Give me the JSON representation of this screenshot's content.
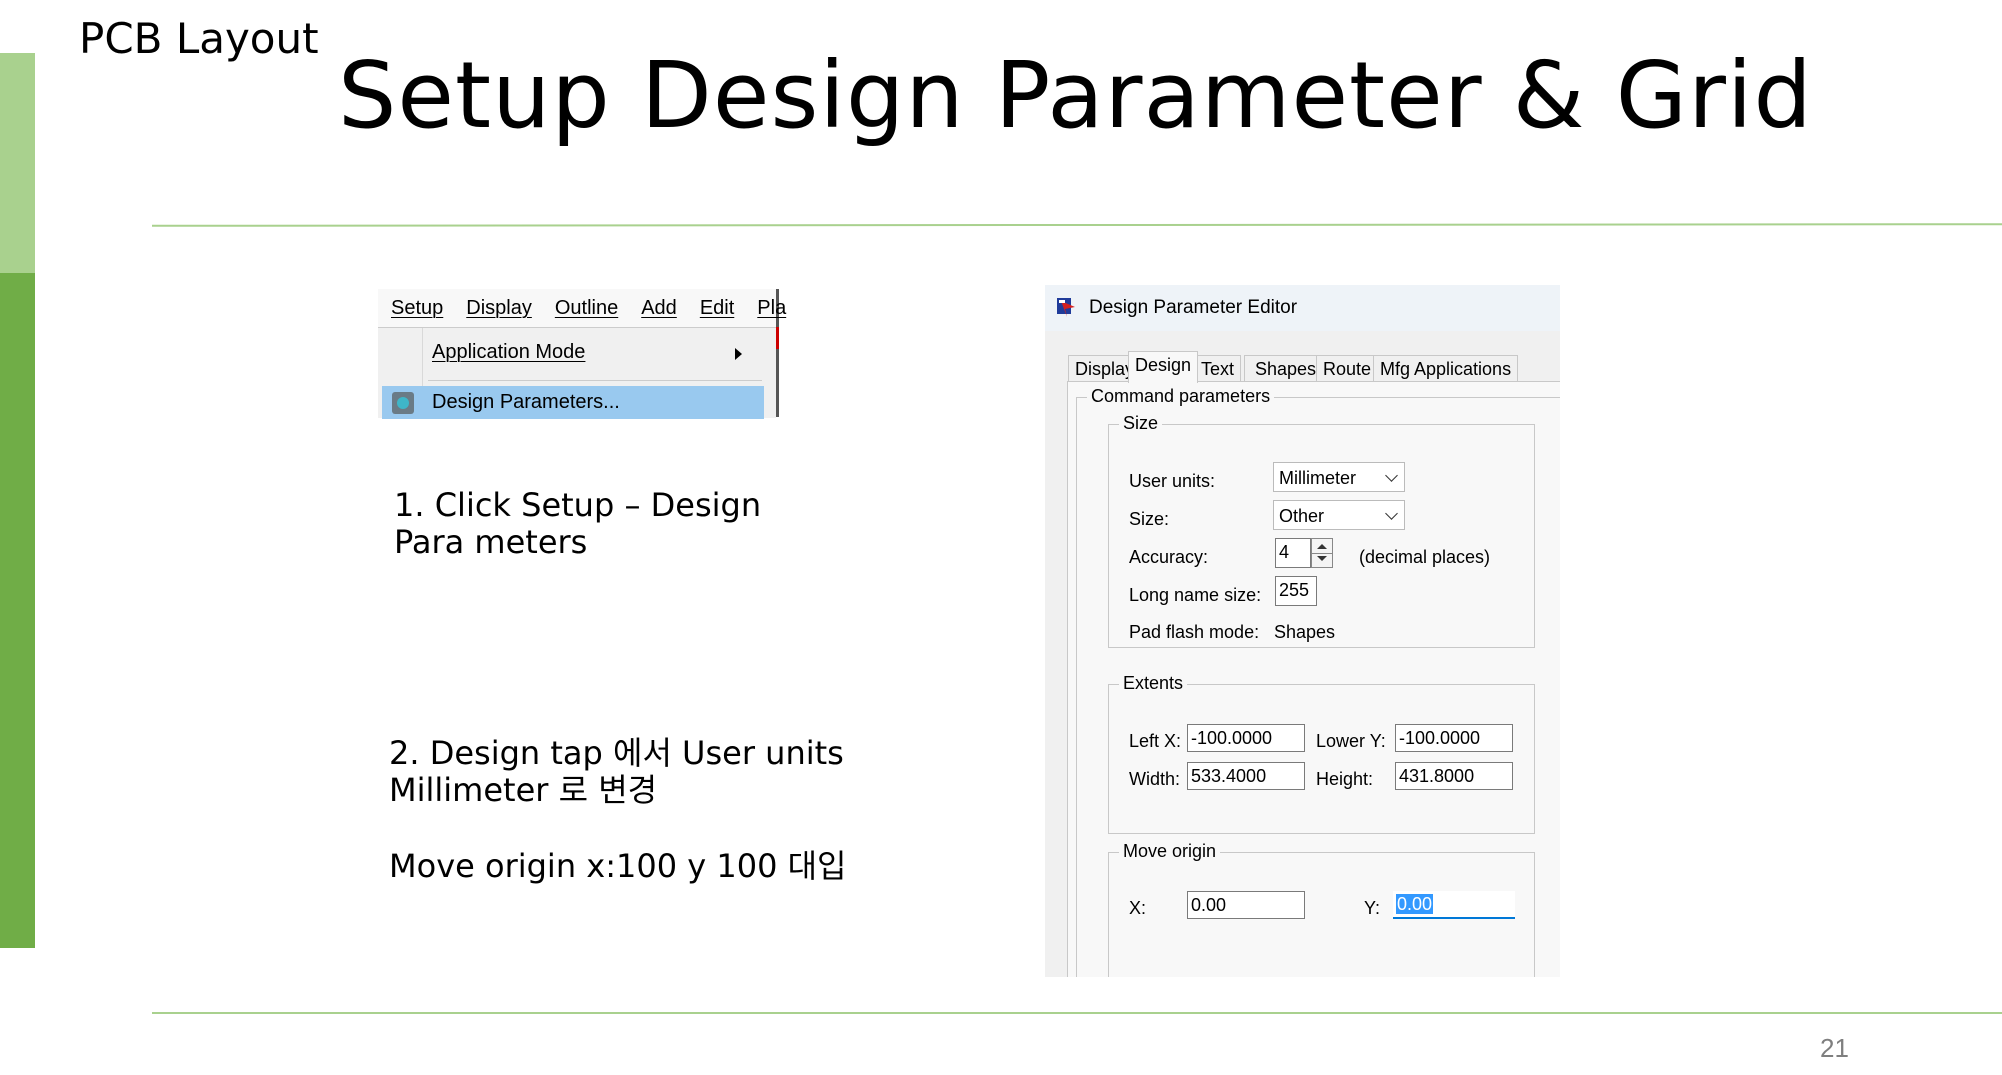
{
  "slide": {
    "kicker": "PCB Layout",
    "title": "Setup Design Parameter & Grid",
    "page_number": "21",
    "accent_light": "#a9d18e",
    "accent_dark": "#70ad47"
  },
  "instructions": {
    "step1": "1. Click Setup – Design\nPara meters",
    "step2": "2. Design tap 에서 User units\nMillimeter 로 변경",
    "step3": "Move origin x:100 y 100 대입"
  },
  "menu": {
    "bar": [
      "Setup",
      "Display",
      "Outline",
      "Add",
      "Edit",
      "Pla"
    ],
    "items": [
      {
        "label": "Application Mode",
        "icon": "submenu-arrow-icon"
      },
      {
        "label": "Design Parameters...",
        "icon": "gear-icon",
        "highlighted": true
      }
    ],
    "highlight_color": "#99c9ef"
  },
  "dialog": {
    "title": "Design Parameter Editor",
    "tabs": [
      "Display",
      "Design",
      "Text",
      "Shapes",
      "Route",
      "Mfg Applications"
    ],
    "active_tab": "Design",
    "command_group": "Command parameters",
    "size": {
      "caption": "Size",
      "user_units_label": "User units:",
      "user_units_value": "Millimeter",
      "size_label": "Size:",
      "size_value": "Other",
      "accuracy_label": "Accuracy:",
      "accuracy_value": "4",
      "accuracy_unit": "(decimal places)",
      "long_name_label": "Long name size:",
      "long_name_value": "255",
      "pad_flash_label": "Pad flash mode:",
      "pad_flash_value": "Shapes"
    },
    "extents": {
      "caption": "Extents",
      "left_x_label": "Left X:",
      "left_x_value": "-100.0000",
      "lower_y_label": "Lower Y:",
      "lower_y_value": "-100.0000",
      "width_label": "Width:",
      "width_value": "533.4000",
      "height_label": "Height:",
      "height_value": "431.8000"
    },
    "move_origin": {
      "caption": "Move origin",
      "x_label": "X:",
      "x_value": "0.00",
      "y_label": "Y:",
      "y_value": "0.00"
    },
    "focus_color": "#0078d7"
  }
}
